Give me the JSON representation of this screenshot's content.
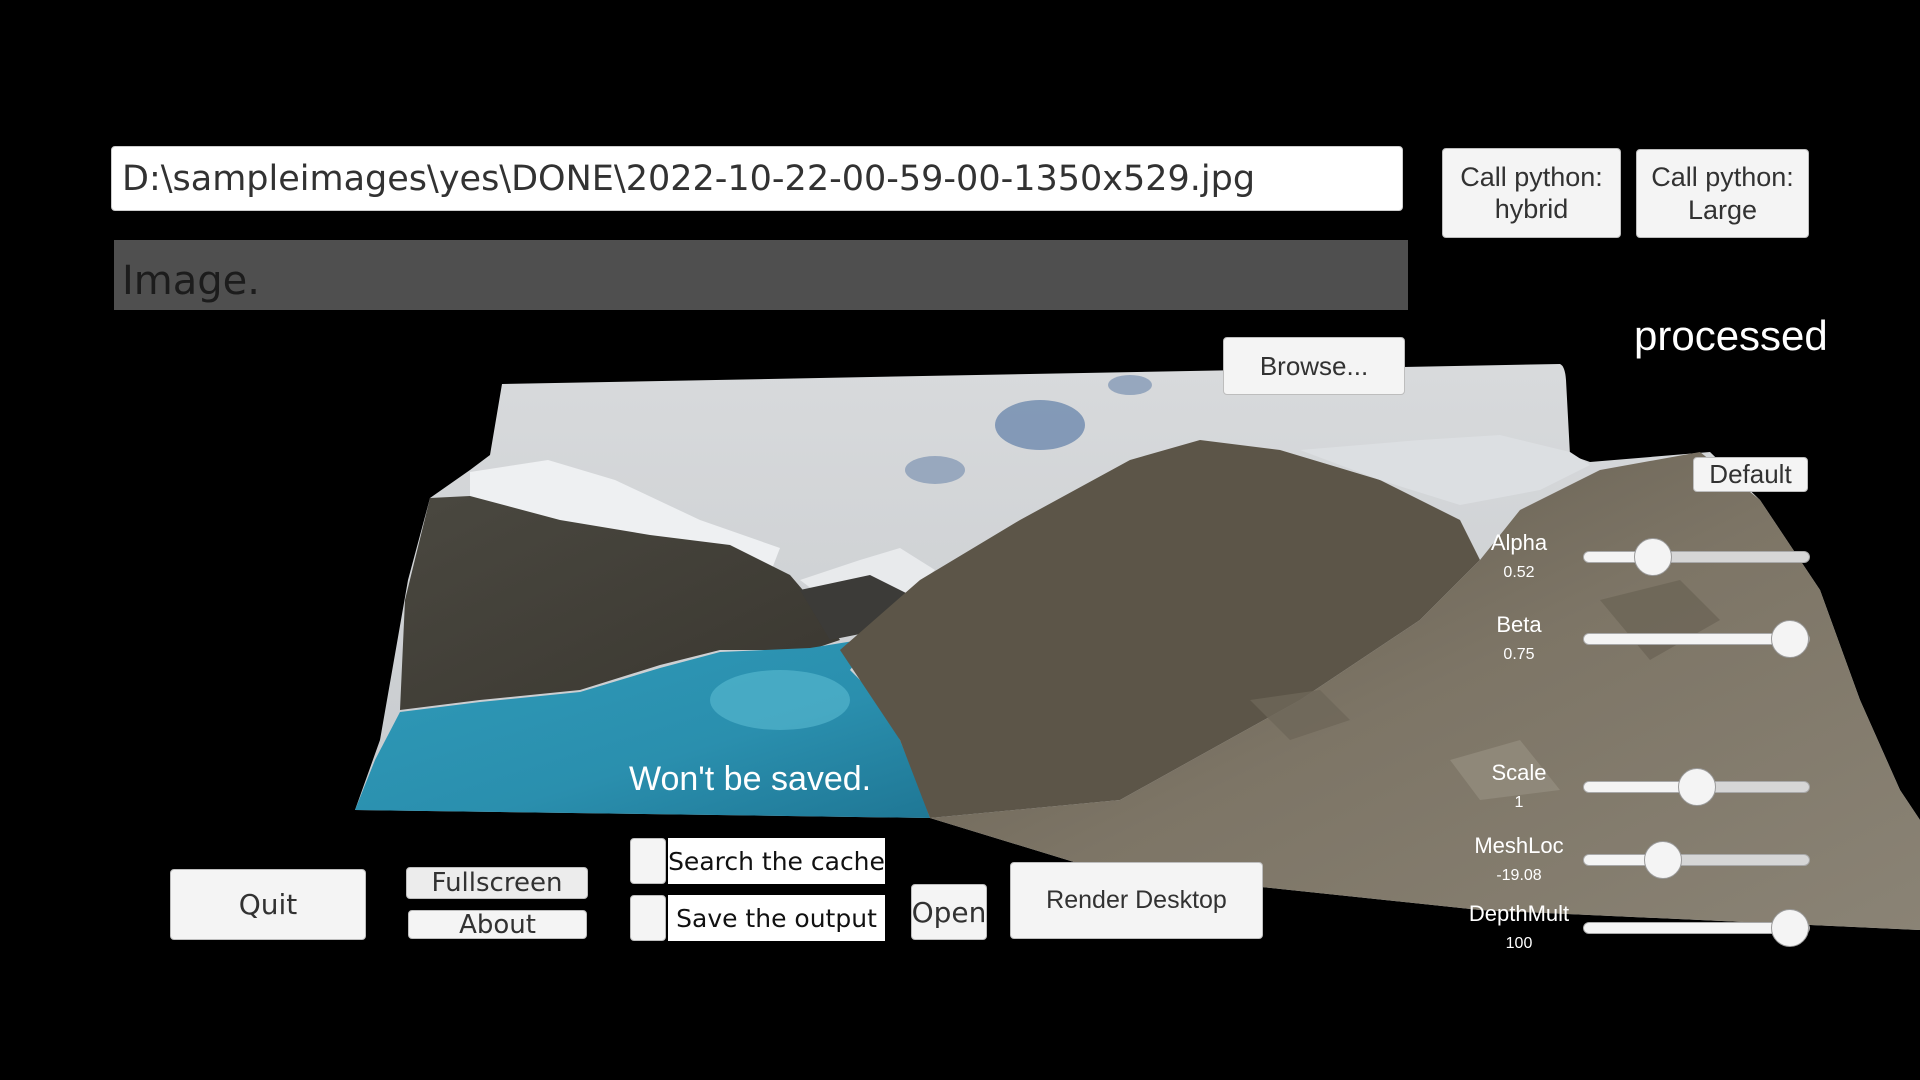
{
  "top": {
    "path_value": "D:\\sampleimages\\yes\\DONE\\2022-10-22-00-59-00-1350x529.jpg",
    "status_text": "Image.",
    "call_hybrid_line1": "Call python:",
    "call_hybrid_line2": "hybrid",
    "call_large_line1": "Call python:",
    "call_large_line2": "Large",
    "processed_label": "processed",
    "browse_label": "Browse..."
  },
  "viewer": {
    "overlay_text": "Won't be saved.",
    "image_description": "3D depth mesh of turquoise mountain lake with snowy peaks and rocky slope"
  },
  "settings": {
    "default_label": "Default",
    "sliders": [
      {
        "name": "Alpha",
        "value": "0.52",
        "fraction": 0.27
      },
      {
        "name": "Beta",
        "value": "0.75",
        "fraction": 1.0
      },
      {
        "name": "Scale",
        "value": "1",
        "fraction": 0.5
      },
      {
        "name": "MeshLoc",
        "value": "-19.08",
        "fraction": 0.32
      },
      {
        "name": "DepthMult",
        "value": "100",
        "fraction": 1.0
      }
    ]
  },
  "bottom": {
    "quit_label": "Quit",
    "fullscreen_label": "Fullscreen",
    "about_label": "About",
    "search_cache_label": "Search the cache",
    "search_cache_checked": false,
    "save_output_label": "Save the output",
    "save_output_checked": false,
    "open_label": "Open",
    "render_desktop_label": "Render Desktop"
  }
}
